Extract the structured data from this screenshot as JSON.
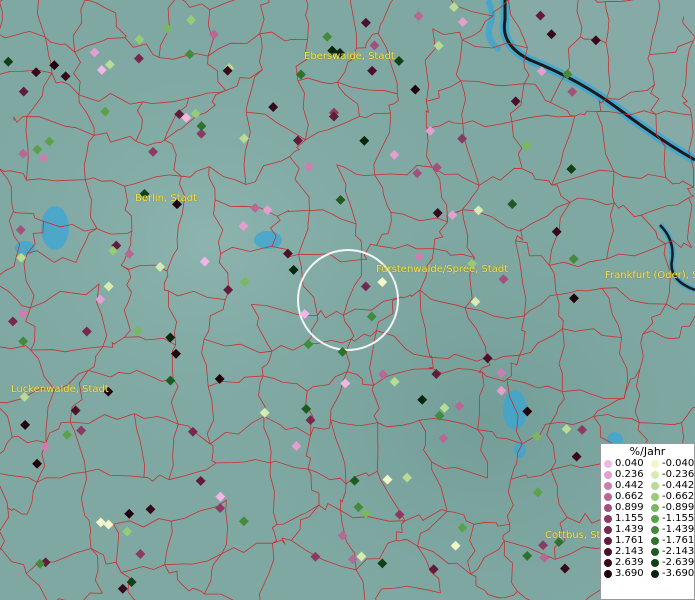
{
  "map": {
    "places": [
      {
        "id": "eberswalde",
        "label": "Eberswalde, Stadt"
      },
      {
        "id": "berlin",
        "label": "Berlin, Stadt"
      },
      {
        "id": "fuerstenwalde",
        "label": "Fürstenwalde/Spree, Stadt"
      },
      {
        "id": "frankfurt",
        "label": "Frankfurt (Oder), S"
      },
      {
        "id": "luckenwalde",
        "label": "Luckenwalde, Stadt"
      },
      {
        "id": "cottbus",
        "label": "Cottbus, St"
      }
    ],
    "colors": {
      "background": "#7fa8a3",
      "boundaries": "#c8302f",
      "water": "#3aa6d4",
      "river_outline": "#1a1a1a",
      "selection_circle": "#ffffff",
      "label": "#f5e24a"
    }
  },
  "legend": {
    "title": "%/Jahr",
    "positive": [
      {
        "value": "0.040",
        "color": "#f2b6e4"
      },
      {
        "value": "0.236",
        "color": "#e39fcf"
      },
      {
        "value": "0.442",
        "color": "#cc7fae"
      },
      {
        "value": "0.662",
        "color": "#b86895"
      },
      {
        "value": "0.899",
        "color": "#a2507c"
      },
      {
        "value": "1.155",
        "color": "#8c3a63"
      },
      {
        "value": "1.439",
        "color": "#76294f"
      },
      {
        "value": "1.761",
        "color": "#611c3b"
      },
      {
        "value": "2.143",
        "color": "#4b112a"
      },
      {
        "value": "2.639",
        "color": "#36091b"
      },
      {
        "value": "3.690",
        "color": "#1f030c"
      }
    ],
    "negative": [
      {
        "value": "-0.040",
        "color": "#f2f6c8"
      },
      {
        "value": "-0.236",
        "color": "#d6ebb0"
      },
      {
        "value": "-0.442",
        "color": "#b7dc93"
      },
      {
        "value": "-0.662",
        "color": "#97cb78"
      },
      {
        "value": "-0.899",
        "color": "#78b85f"
      },
      {
        "value": "-1.155",
        "color": "#5aa24a"
      },
      {
        "value": "-1.439",
        "color": "#438a3a"
      },
      {
        "value": "-1.761",
        "color": "#30722d"
      },
      {
        "value": "-2.143",
        "color": "#1f5a21"
      },
      {
        "value": "-2.639",
        "color": "#124016"
      },
      {
        "value": "-3.690",
        "color": "#07260b"
      }
    ]
  },
  "stations": [
    {
      "value": 1.155
    },
    {
      "value": 2.639
    },
    {
      "value": 0.236
    },
    {
      "value": -1.439
    },
    {
      "value": 1.761
    },
    {
      "value": -0.442
    },
    {
      "value": 3.69
    },
    {
      "value": 0.662
    },
    {
      "value": -0.899
    },
    {
      "value": 2.143
    },
    {
      "value": -2.639
    },
    {
      "value": 0.442
    },
    {
      "value": -0.236
    },
    {
      "value": 1.439
    },
    {
      "value": -1.155
    },
    {
      "value": 0.04
    },
    {
      "value": -3.69
    },
    {
      "value": 0.899
    },
    {
      "value": -0.662
    },
    {
      "value": 2.639
    },
    {
      "value": -1.761
    },
    {
      "value": 1.155
    },
    {
      "value": -0.04
    },
    {
      "value": 3.69
    },
    {
      "value": -2.143
    },
    {
      "value": 0.236
    },
    {
      "value": 1.761
    },
    {
      "value": -0.442
    },
    {
      "value": 0.662
    },
    {
      "value": -1.439
    }
  ]
}
